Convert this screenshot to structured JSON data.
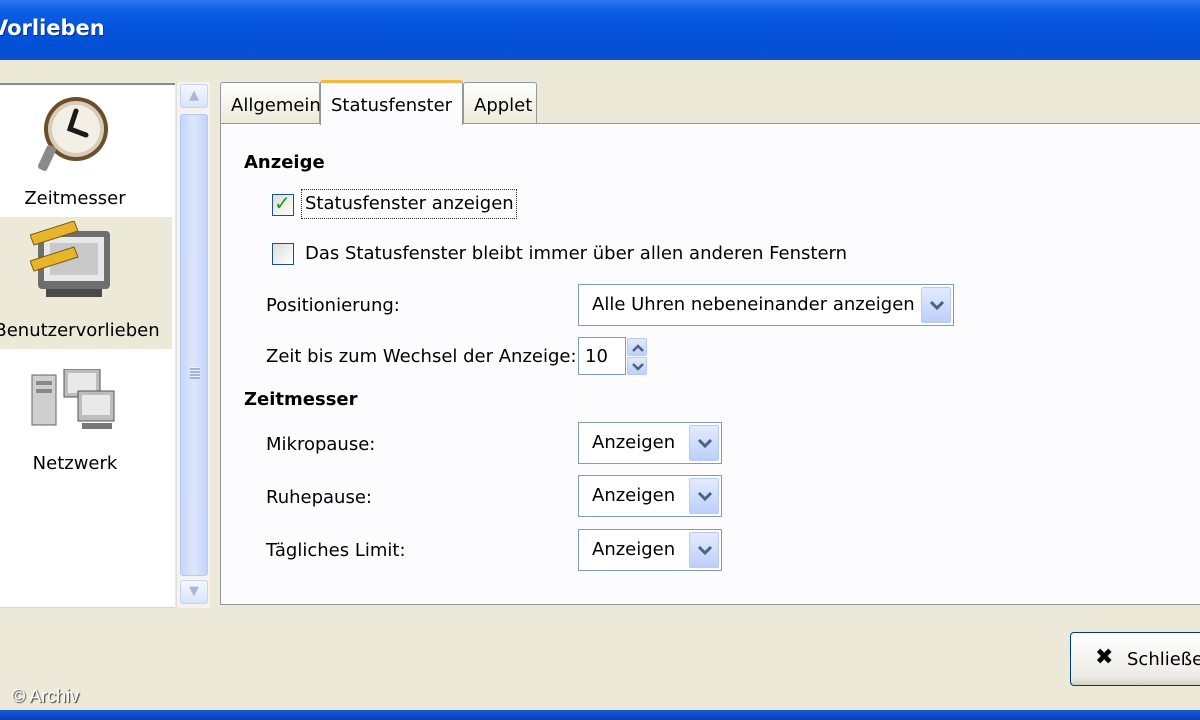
{
  "window": {
    "title": "Vorlieben"
  },
  "sidebar": {
    "items": [
      {
        "label": "Zeitmesser",
        "icon": "clock-icon",
        "selected": false
      },
      {
        "label": "Benutzervorlieben",
        "icon": "monitor-ruler-icon",
        "selected": true
      },
      {
        "label": "Netzwerk",
        "icon": "network-computers-icon",
        "selected": false
      }
    ]
  },
  "tabs": [
    {
      "label": "Allgemein",
      "active": false
    },
    {
      "label": "Statusfenster",
      "active": true
    },
    {
      "label": "Applet",
      "active": false
    }
  ],
  "anzeige": {
    "title": "Anzeige",
    "show_status_window": {
      "label": "Statusfenster anzeigen",
      "checked": true
    },
    "always_on_top": {
      "label": "Das Statusfenster bleibt immer über allen anderen Fenstern",
      "checked": false
    },
    "positioning": {
      "label": "Positionierung:",
      "value": "Alle Uhren nebeneinander anzeigen"
    },
    "switch_time": {
      "label": "Zeit bis zum Wechsel der Anzeige:",
      "value": "10"
    }
  },
  "zeitmesser": {
    "title": "Zeitmesser",
    "micropause": {
      "label": "Mikropause:",
      "value": "Anzeigen"
    },
    "restbreak": {
      "label": "Ruhepause:",
      "value": "Anzeigen"
    },
    "daily_limit": {
      "label": "Tägliches Limit:",
      "value": "Anzeigen"
    }
  },
  "footer": {
    "close_label": "Schließen"
  },
  "watermark": "© Archiv",
  "colors": {
    "titlebar": "#0453db",
    "dialog_bg": "#ece9d8",
    "active_tab_accent": "#f6b741",
    "check": "#21a121"
  }
}
